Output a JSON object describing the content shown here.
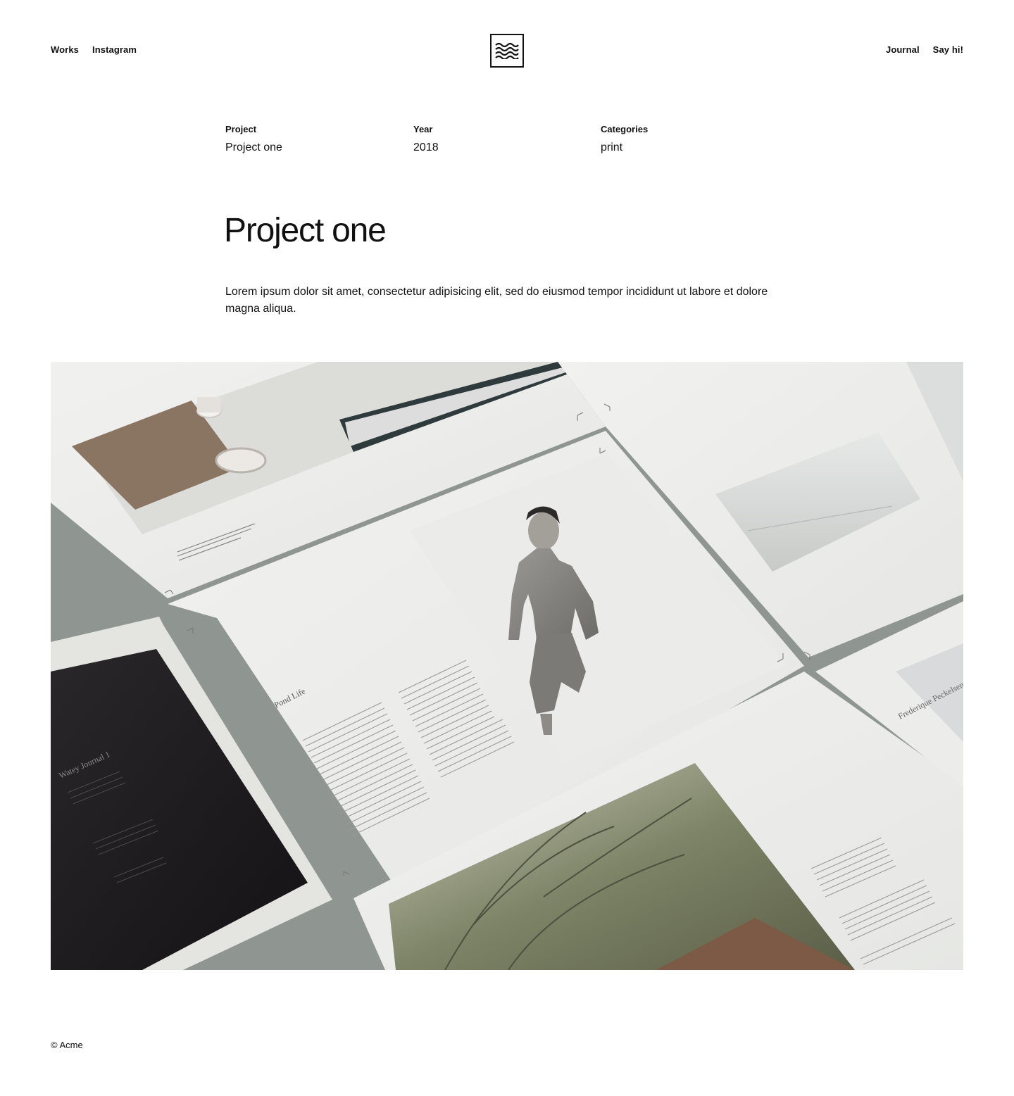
{
  "header": {
    "nav_left": [
      {
        "label": "Works"
      },
      {
        "label": "Instagram"
      }
    ],
    "logo_icon": "waves-logo-icon",
    "nav_right": [
      {
        "label": "Journal"
      },
      {
        "label": "Say hi!"
      }
    ]
  },
  "meta": {
    "project_label": "Project",
    "project_value": "Project one",
    "year_label": "Year",
    "year_value": "2018",
    "categories_label": "Categories",
    "categories_value": "print"
  },
  "page": {
    "title": "Project one",
    "description": "Lorem ipsum dolor sit amet, consectetur adipisicing elit, sed do eiusmod tempor incididunt ut labore et dolore magna aliqua."
  },
  "hero": {
    "heading_1": "Pond Life",
    "heading_2": "Frederique Peckelsen",
    "heading_3": "Watey Journal 1"
  },
  "footer": {
    "copyright": "© Acme"
  },
  "colors": {
    "text": "#111111",
    "paper": "#efefed",
    "gap": "#8f9590",
    "dark_page": "#1b191b"
  }
}
